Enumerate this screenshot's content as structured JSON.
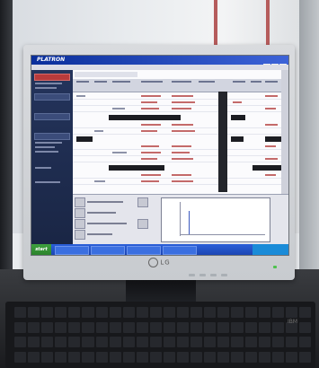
{
  "scene": {
    "monitor_brand": "LG",
    "keyboard_brand": "IBM"
  },
  "software": {
    "app_title": "PLATRON",
    "start_label": "start"
  },
  "colors": {
    "titlebar": "#0b2f9b",
    "sidebar": "#24345c",
    "active_nav": "#b93b3b",
    "taskbar": "#2b5fd9",
    "start_button": "#3fa23f"
  }
}
